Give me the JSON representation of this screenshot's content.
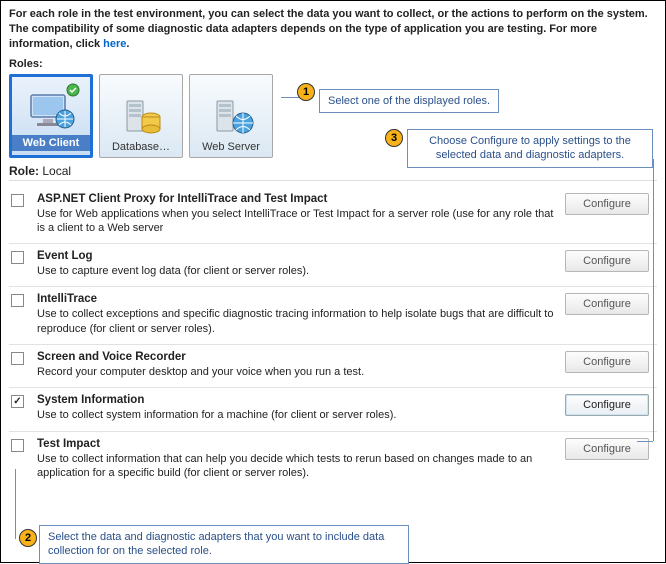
{
  "intro": {
    "text_a": "For each role in the test environment, you can select the data you want to collect, or the actions to perform on the system. The compatibility of some diagnostic data adapters depends on the type of application you are testing. For more information, click ",
    "link": "here",
    "text_b": "."
  },
  "roles_label": "Roles:",
  "roles": [
    {
      "label": "Web Client",
      "selected": true,
      "icon": "monitor-globe",
      "badge": true
    },
    {
      "label": "Database…",
      "selected": false,
      "icon": "server-db",
      "badge": false
    },
    {
      "label": "Web Server",
      "selected": false,
      "icon": "server-globe",
      "badge": false
    }
  ],
  "role_line": {
    "label": "Role:",
    "value": "Local"
  },
  "adapters": [
    {
      "title": "ASP.NET Client Proxy for IntelliTrace and Test Impact",
      "desc": "Use for Web applications when you select IntelliTrace or Test Impact for a server role (use for any role that is a client to a Web server",
      "checked": false,
      "configure": "Configure",
      "active": false
    },
    {
      "title": "Event Log",
      "desc": "Use to capture event log data (for client or server roles).",
      "checked": false,
      "configure": "Configure",
      "active": false
    },
    {
      "title": "IntelliTrace",
      "desc": "Use to collect exceptions and specific diagnostic tracing information to help isolate bugs that are difficult to reproduce (for client or server roles).",
      "checked": false,
      "configure": "Configure",
      "active": false
    },
    {
      "title": "Screen and Voice Recorder",
      "desc": "Record your computer desktop and your voice when you run a test.",
      "checked": false,
      "configure": "Configure",
      "active": false
    },
    {
      "title": "System Information",
      "desc": "Use to collect system information for a machine (for client or server roles).",
      "checked": true,
      "configure": "Configure",
      "active": true
    },
    {
      "title": "Test Impact",
      "desc": "Use to collect information that can help you decide which tests to rerun based on changes made to an application for a specific build (for client or server roles).",
      "checked": false,
      "configure": "Configure",
      "active": false
    }
  ],
  "callouts": {
    "c1": "Select one of the displayed roles.",
    "c2": "Select the data and diagnostic adapters that you want to include data collection for on the selected role.",
    "c3": "Choose Configure to apply settings to the selected data and diagnostic adapters."
  }
}
